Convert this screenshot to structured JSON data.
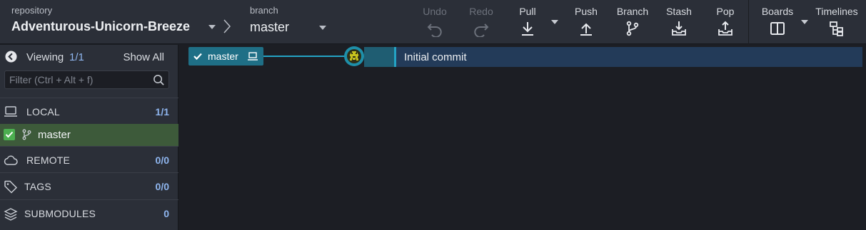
{
  "toolbar": {
    "repo_caption": "repository",
    "repo_name": "Adventurous-Unicorn-Breeze",
    "branch_caption": "branch",
    "branch_name": "master",
    "buttons": {
      "undo": "Undo",
      "redo": "Redo",
      "pull": "Pull",
      "push": "Push",
      "branch": "Branch",
      "stash": "Stash",
      "pop": "Pop",
      "boards": "Boards",
      "timelines": "Timelines"
    }
  },
  "sidebar": {
    "viewing_label": "Viewing",
    "viewing_count": "1/1",
    "show_all": "Show All",
    "filter_placeholder": "Filter (Ctrl + Alt + f)",
    "sections": {
      "local": {
        "label": "LOCAL",
        "count": "1/1"
      },
      "remote": {
        "label": "REMOTE",
        "count": "0/0"
      },
      "tags": {
        "label": "TAGS",
        "count": "0/0"
      },
      "submodules": {
        "label": "SUBMODULES",
        "count": "0"
      }
    },
    "local_branches": [
      {
        "name": "master",
        "checked": true
      }
    ]
  },
  "graph": {
    "ref_label": "master",
    "commits": [
      {
        "message": "Initial commit"
      }
    ]
  },
  "colors": {
    "accent": "#24a3c4",
    "active_branch_bg": "#3d5a3a",
    "selected_commit_bg": "#233b59",
    "count_blue": "#8fb6ef"
  }
}
